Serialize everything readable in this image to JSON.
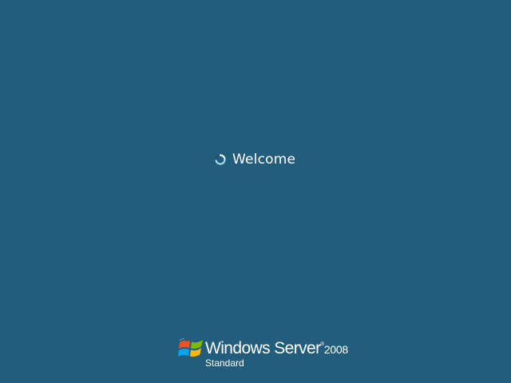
{
  "screen": {
    "background": "#235d7d",
    "status_text": "Welcome",
    "status_icon": "loading-spinner-icon"
  },
  "branding": {
    "logo_icon": "windows-flag-logo-icon",
    "product_name": "Windows Server",
    "trademark": "®",
    "version": "2008",
    "edition": "Standard"
  }
}
